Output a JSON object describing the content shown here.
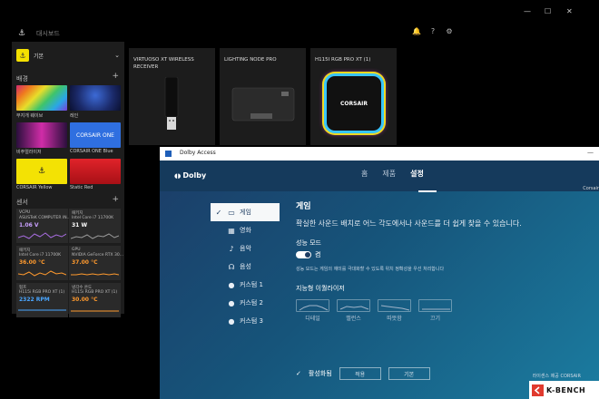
{
  "icue": {
    "nav_label": "대시보드",
    "profile": {
      "name": "기본"
    },
    "backgrounds": {
      "title": "배경",
      "tiles": [
        {
          "label": "무지개 웨이브"
        },
        {
          "label": "레인"
        },
        {
          "label": "비주얼라이저"
        },
        {
          "label": "CORSAIR ONE Blue",
          "art": "CORSAIR ONE"
        },
        {
          "label": "CORSAIR Yellow"
        },
        {
          "label": "Static Red"
        }
      ]
    },
    "sensors": {
      "title": "센서",
      "items": [
        {
          "line1": "VCPU",
          "line2": "ASUSTeK COMPUTER IN...",
          "value": "1.06 V",
          "color": "#c9a0ff"
        },
        {
          "line1": "패키지",
          "line2": "Intel Core i7 11700K",
          "value": "31 W",
          "color": "#ffffff"
        },
        {
          "line1": "패키지",
          "line2": "Intel Core i7 11700K",
          "value": "36.00 °C",
          "color": "#ff9a2e"
        },
        {
          "line1": "GPU",
          "line2": "NVIDIA GeForce RTX 30...",
          "value": "37.00 °C",
          "color": "#ff9a2e"
        },
        {
          "line1": "펌프",
          "line2": "H115i RGB PRO XT (1)",
          "value": "2322 RPM",
          "color": "#4aa6ff"
        },
        {
          "line1": "냉각수 온도",
          "line2": "H115i RGB PRO XT (1)",
          "value": "30.00 °C",
          "color": "#ff9a2e"
        }
      ]
    },
    "devices": [
      {
        "name": "VIRTUOSO XT WIRELESS RECEIVER"
      },
      {
        "name": "LIGHTING NODE PRO"
      },
      {
        "name": "H115I RGB PRO XT (1)",
        "brand": "CORSAIR"
      }
    ]
  },
  "dolby": {
    "window_title": "Dolby Access",
    "logo": "Dolby",
    "tabs": [
      "홈",
      "제품",
      "설정"
    ],
    "active_tab": "설정",
    "user": "Corsair",
    "menu": [
      {
        "label": "게임",
        "icon": "gamepad-icon",
        "active": true
      },
      {
        "label": "영화",
        "icon": "film-icon"
      },
      {
        "label": "음악",
        "icon": "music-icon"
      },
      {
        "label": "음성",
        "icon": "voice-icon"
      },
      {
        "label": "커스텀 1",
        "icon": "person-icon"
      },
      {
        "label": "커스텀 2",
        "icon": "person-icon"
      },
      {
        "label": "커스텀 3",
        "icon": "person-icon"
      }
    ],
    "content": {
      "title": "게임",
      "description": "확실한 사운드 배치로 어느 각도에서나 사운드를 더 쉽게 찾을 수 있습니다.",
      "perf_mode_label": "성능 모드",
      "perf_mode_state": "켬",
      "perf_mode_desc": "성능 모드는 게임의 재미를 극대화할 수 있도록 위치 정확성을 우선 처리합니다",
      "eq_title": "지능형 이퀄라이저",
      "eq_presets": [
        "디테일",
        "밸런스",
        "따뜻함",
        "끄기"
      ]
    },
    "footer": {
      "enabled_label": "활성화됨",
      "apply_button": "적용",
      "default_button": "기본",
      "license": "라이센스 제공",
      "license_brand": "CORSAIR"
    }
  },
  "watermark": {
    "brand": "K-BENCH"
  }
}
